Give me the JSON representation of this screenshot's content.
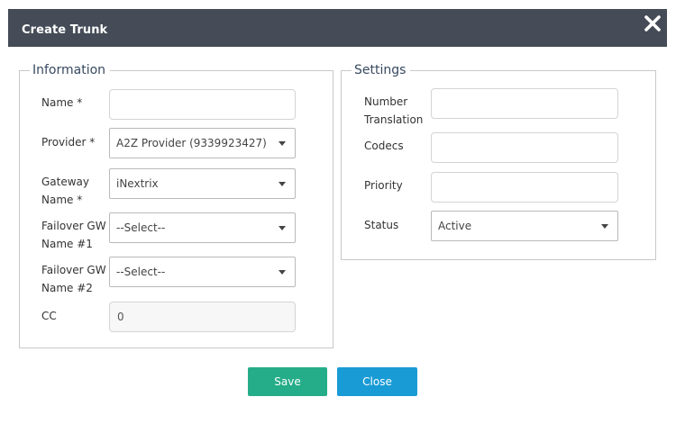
{
  "dialog": {
    "title": "Create Trunk",
    "close_icon": "close-icon"
  },
  "information": {
    "legend": "Information",
    "name": {
      "label": "Name *",
      "value": ""
    },
    "provider": {
      "label": "Provider *",
      "value": "A2Z Provider (9339923427)"
    },
    "gateway": {
      "label_line1": "Gateway",
      "label_line2": "Name *",
      "value": "iNextrix"
    },
    "failover1": {
      "label_line1": "Failover GW",
      "label_line2": "Name #1",
      "value": "--Select--"
    },
    "failover2": {
      "label_line1": "Failover GW",
      "label_line2": "Name #2",
      "value": "--Select--"
    },
    "cc": {
      "label": "CC",
      "value": "0"
    }
  },
  "settings": {
    "legend": "Settings",
    "number_translation": {
      "label_line1": "Number",
      "label_line2": "Translation",
      "value": ""
    },
    "codecs": {
      "label": "Codecs",
      "value": ""
    },
    "priority": {
      "label": "Priority",
      "value": ""
    },
    "status": {
      "label": "Status",
      "value": "Active"
    }
  },
  "buttons": {
    "save": "Save",
    "close": "Close"
  },
  "colors": {
    "titlebar": "#454c57",
    "save": "#24ad88",
    "close": "#199bd5",
    "legend_text": "#37495f"
  }
}
